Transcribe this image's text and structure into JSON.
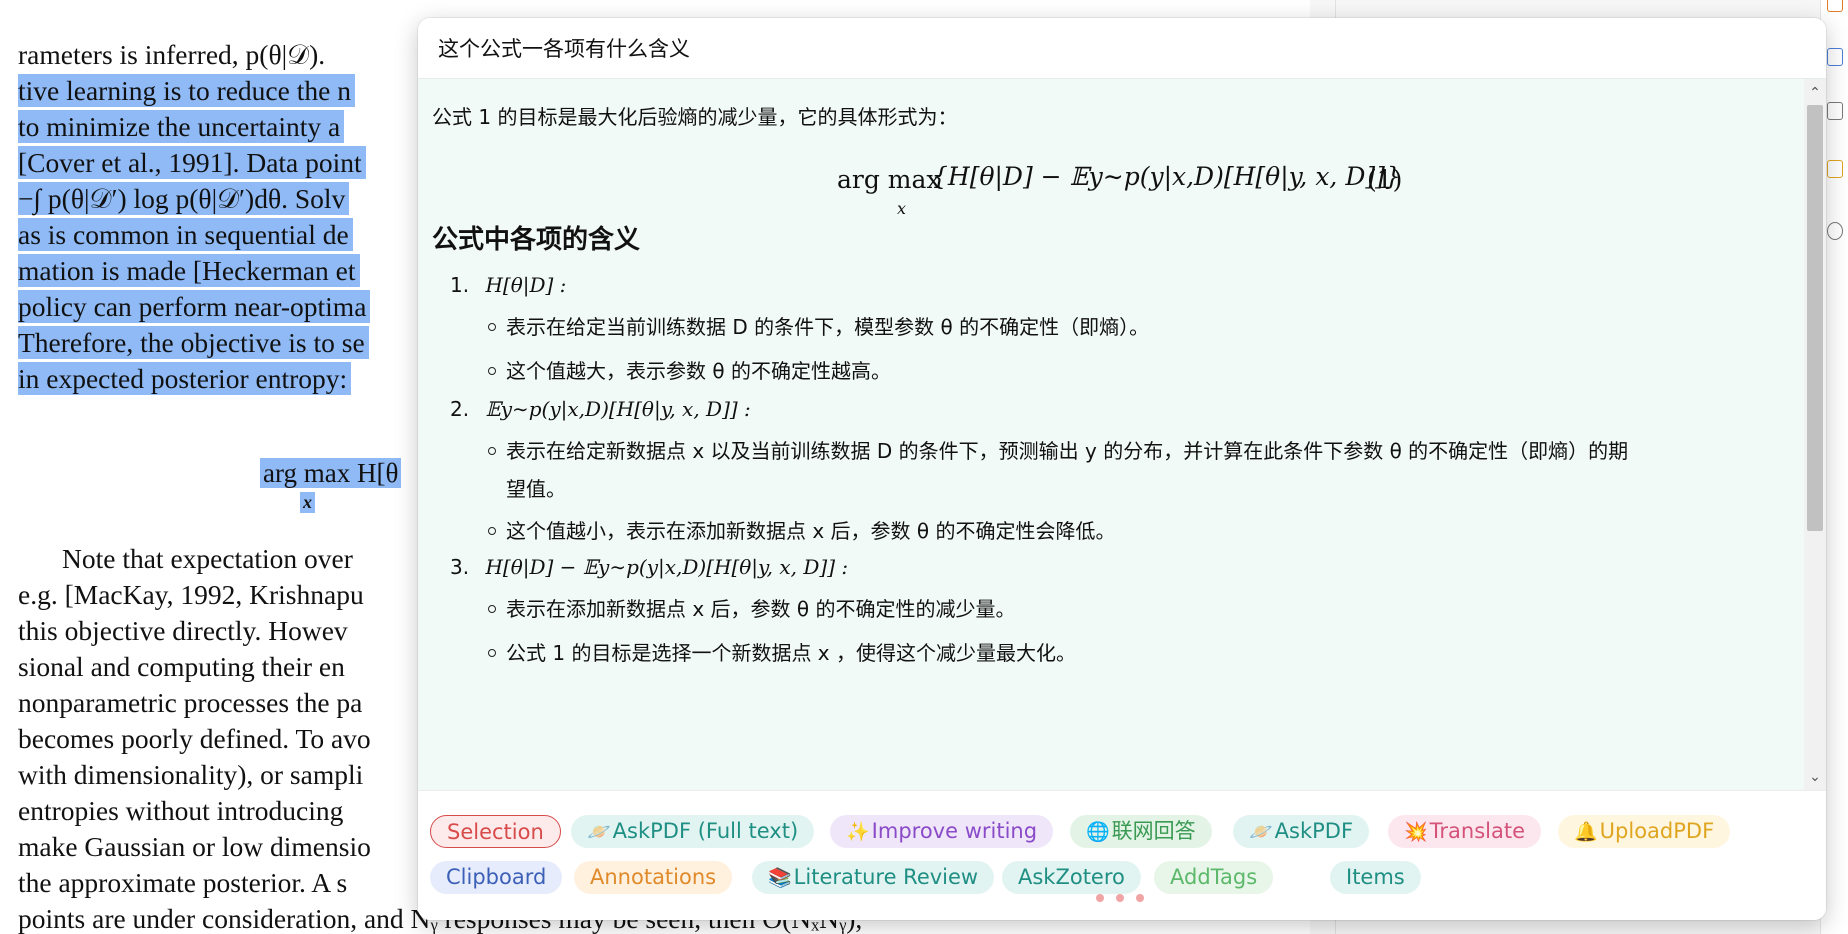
{
  "pdf": {
    "lines": [
      {
        "text": "rameters is inferred, p(θ|𝒟).",
        "hl": false,
        "indent": false
      },
      {
        "text": "tive learning is to reduce the n",
        "hl": true,
        "indent": false
      },
      {
        "text": "to minimize the uncertainty a",
        "hl": true,
        "indent": false
      },
      {
        "text": "[Cover et al., 1991]. Data point",
        "hl": true,
        "indent": false
      },
      {
        "text": "−∫ p(θ|𝒟′) log p(θ|𝒟′)dθ. Solv",
        "hl": true,
        "indent": false
      },
      {
        "text": "as is common in sequential de",
        "hl": true,
        "indent": false
      },
      {
        "text": "mation is made [Heckerman et",
        "hl": true,
        "indent": false
      },
      {
        "text": "policy can perform near-optima",
        "hl": true,
        "indent": false
      },
      {
        "text": "Therefore, the objective is to se",
        "hl": true,
        "indent": false
      },
      {
        "text": "in expected posterior entropy:",
        "hl": true,
        "indent": false
      },
      {
        "text": "Note that expectation over",
        "hl": false,
        "indent": true
      },
      {
        "text": "e.g. [MacKay, 1992, Krishnapu",
        "hl": false,
        "indent": false
      },
      {
        "text": "this objective directly. Howev",
        "hl": false,
        "indent": false
      },
      {
        "text": "sional and computing their en",
        "hl": false,
        "indent": false
      },
      {
        "text": "nonparametric processes the pa",
        "hl": false,
        "indent": false
      },
      {
        "text": "becomes poorly defined. To avo",
        "hl": false,
        "indent": false
      },
      {
        "text": "with dimensionality), or sampli",
        "hl": false,
        "indent": false
      },
      {
        "text": "entropies without introducing",
        "hl": false,
        "indent": false
      },
      {
        "text": "make Gaussian or low dimensio",
        "hl": false,
        "indent": false
      },
      {
        "text": "the approximate posterior. A s",
        "hl": false,
        "indent": false
      },
      {
        "text": "points are under consideration, and Nᵧ responses may be seen, then O(NₓNᵧ),",
        "hl": false,
        "indent": false
      }
    ],
    "eq_main": "arg max H[θ",
    "eq_sub": "x"
  },
  "popup": {
    "prompt_value": "这个公式一各项有什么含义",
    "intro": "公式 1 的目标是最大化后验熵的减少量，它的具体形式为：",
    "equation": {
      "argmax": "arg max",
      "argmax_sub": "x",
      "body": "{H[θ|D] − 𝔼y∼p(y|x,D)[H[θ|y, x, D]]}",
      "number": "(1)"
    },
    "section_title": "公式中各项的含义",
    "items": [
      {
        "num": "1.",
        "formula": "H[θ|D] :",
        "bullets": [
          "表示在给定当前训练数据 D 的条件下，模型参数 θ 的不确定性（即熵）。",
          "这个值越大，表示参数 θ 的不确定性越高。"
        ]
      },
      {
        "num": "2.",
        "formula": "𝔼y∼p(y|x,D)[H[θ|y, x, D]] :",
        "bullets": [
          "表示在给定新数据点 x 以及当前训练数据 D 的条件下，预测输出 y 的分布，并计算在此条件下参数 θ 的不确定性（即熵）的期",
          "望值。",
          "这个值越小，表示在添加新数据点 x 后，参数 θ 的不确定性会降低。"
        ]
      },
      {
        "num": "3.",
        "formula": "H[θ|D] − 𝔼y∼p(y|x,D)[H[θ|y, x, D]] :",
        "bullets": [
          "表示在添加新数据点 x 后，参数 θ 的不确定性的减少量。",
          "公式 1 的目标是选择一个新数据点 x ，使得这个减少量最大化。"
        ]
      }
    ]
  },
  "chips": [
    {
      "label": "Selection",
      "emoji": "",
      "color": "#d84b4b",
      "bg": "#fdeaea",
      "border": "#d84b4b"
    },
    {
      "label": "AskPDF (Full text)",
      "emoji": "🪐",
      "color": "#1f8f84",
      "bg": "#e2f4f1",
      "border": ""
    },
    {
      "label": "Improve writing",
      "emoji": "✨",
      "color": "#8a4bc8",
      "bg": "#efe6f9",
      "border": ""
    },
    {
      "label": "联网回答",
      "emoji": "🌐",
      "color": "#3a9a54",
      "bg": "#e3f4e6",
      "border": ""
    },
    {
      "label": "AskPDF",
      "emoji": "🪐",
      "color": "#1f8f84",
      "bg": "#e2f4f1",
      "border": ""
    },
    {
      "label": "Translate",
      "emoji": "💥",
      "color": "#d4537a",
      "bg": "#fde7ee",
      "border": ""
    },
    {
      "label": "UploadPDF",
      "emoji": "🔔",
      "color": "#e0a520",
      "bg": "#fff6df",
      "border": ""
    },
    {
      "label": "Clipboard",
      "emoji": "",
      "color": "#3c5fb8",
      "bg": "#e6ecfb",
      "border": ""
    },
    {
      "label": "Annotations",
      "emoji": "",
      "color": "#e08a2a",
      "bg": "#fff1de",
      "border": ""
    },
    {
      "label": "Literature Review",
      "emoji": "📚",
      "color": "#1f8f84",
      "bg": "#e2f4f1",
      "border": ""
    },
    {
      "label": "AskZotero",
      "emoji": "",
      "color": "#1f8f84",
      "bg": "#e2f4f1",
      "border": ""
    },
    {
      "label": "AddTags",
      "emoji": "",
      "color": "#5cb86a",
      "bg": "#e7f6e9",
      "border": ""
    },
    {
      "label": "Items",
      "emoji": "",
      "color": "#1f8f84",
      "bg": "#e2f4f1",
      "border": ""
    }
  ]
}
